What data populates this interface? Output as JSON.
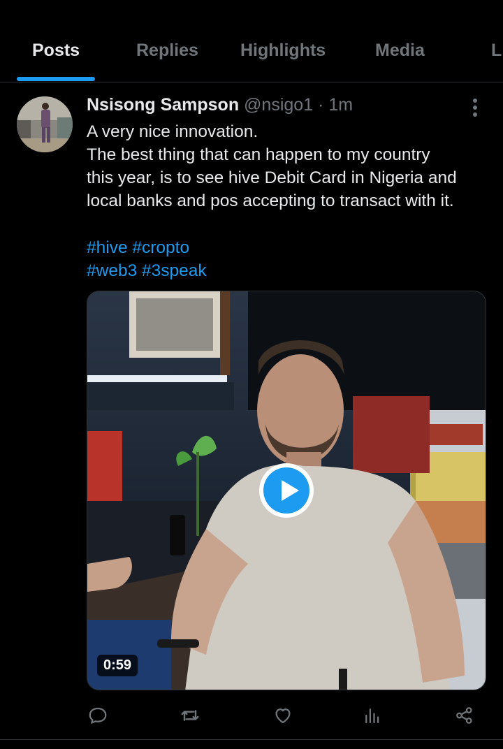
{
  "tabs": [
    {
      "label": "Posts",
      "active": true
    },
    {
      "label": "Replies",
      "active": false
    },
    {
      "label": "Highlights",
      "active": false
    },
    {
      "label": "Media",
      "active": false
    },
    {
      "label": "Li",
      "active": false
    }
  ],
  "post": {
    "author_name": "Nsisong Sampson",
    "handle": "@nsigo1",
    "separator": " · ",
    "time": "1m",
    "lines": [
      "A very nice innovation.",
      "The best thing that can happen to my country",
      "this year, is to see hive Debit Card in Nigeria and",
      "local banks and pos accepting to transact with it."
    ],
    "hashtag_lines": [
      [
        "#hive",
        "#cropto"
      ],
      [
        "#web3",
        "#3speak"
      ]
    ],
    "video": {
      "duration": "0:59"
    }
  },
  "actions": [
    {
      "icon": "reply-icon"
    },
    {
      "icon": "repost-icon"
    },
    {
      "icon": "like-icon"
    },
    {
      "icon": "views-icon"
    },
    {
      "icon": "share-icon"
    }
  ],
  "colors": {
    "background": "#000000",
    "accent": "#1d9bf0",
    "text": "#e7e9ea",
    "muted": "#71767b",
    "divider": "#2f3336"
  }
}
